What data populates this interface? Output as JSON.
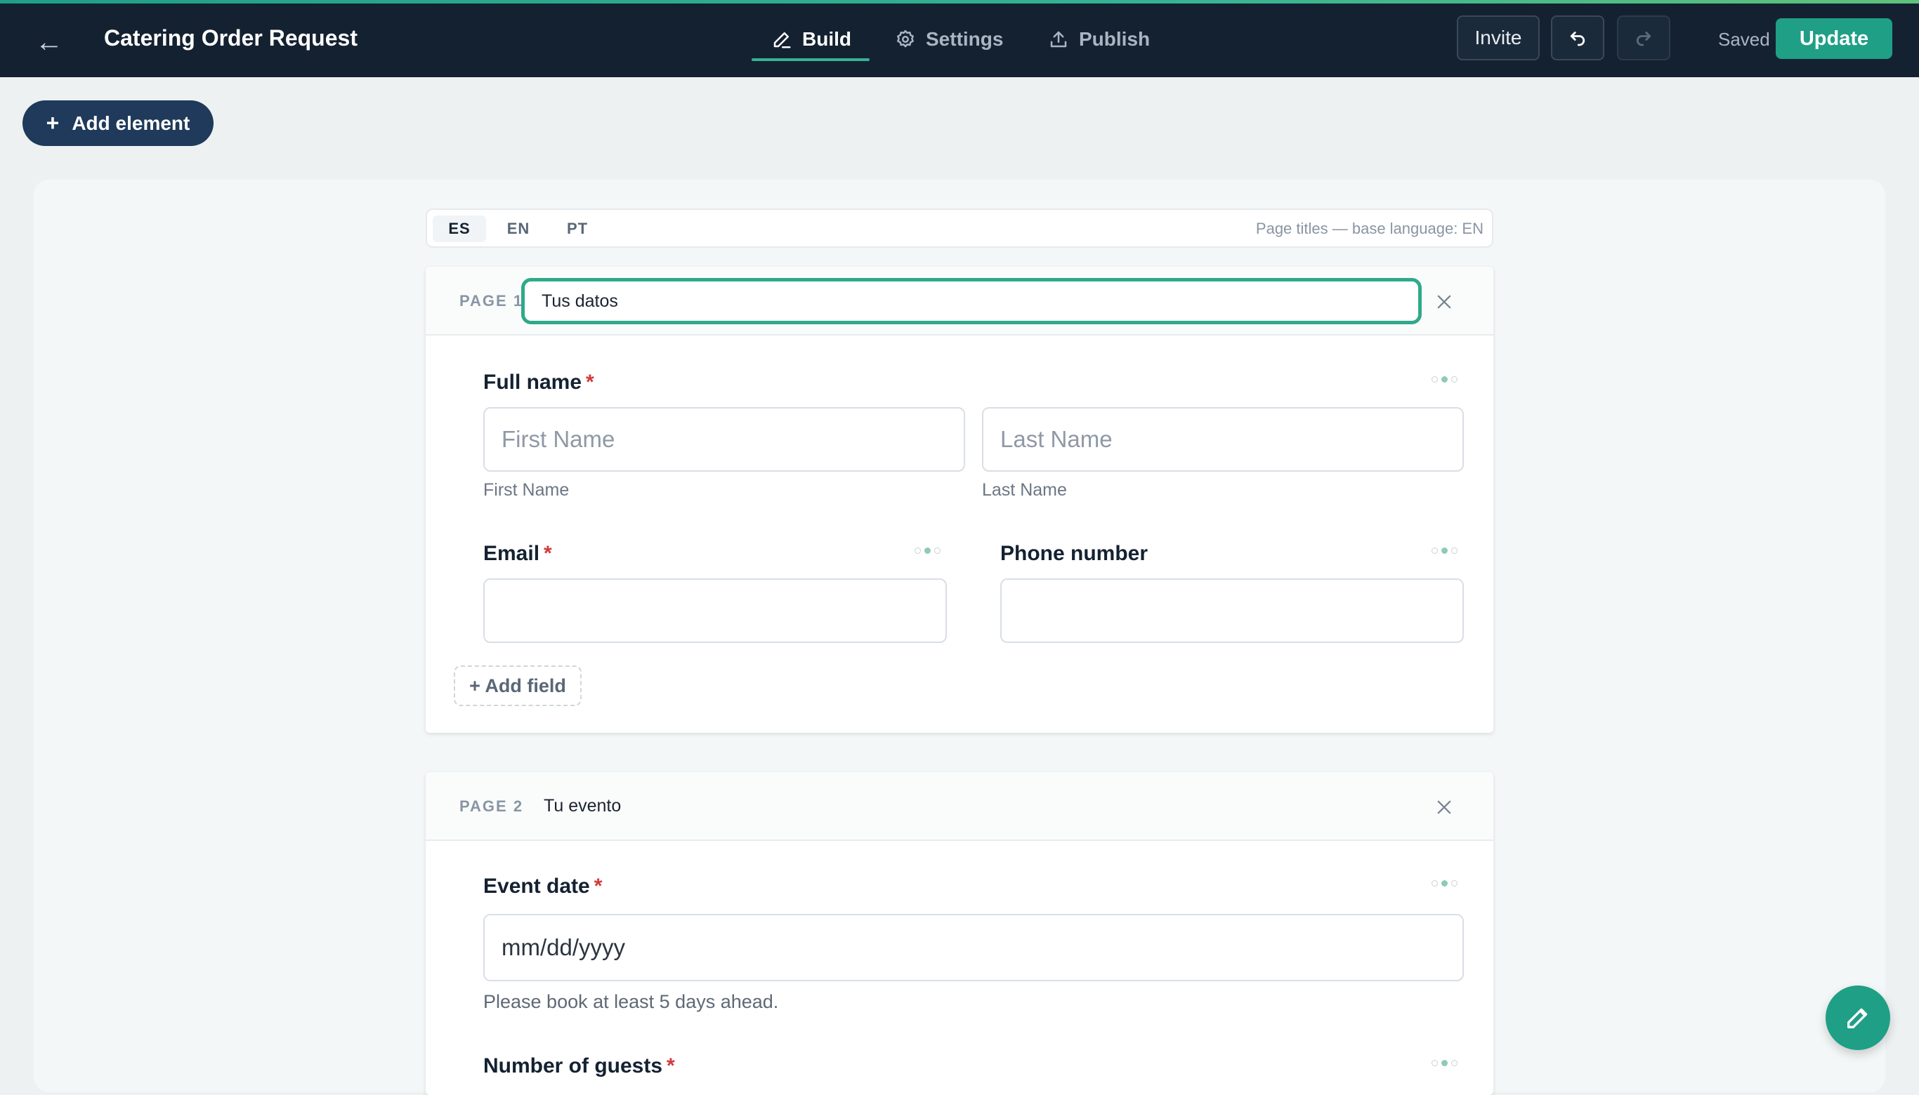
{
  "header": {
    "title": "Catering Order Request",
    "tabs": [
      {
        "label": "Build",
        "icon": "pencil-icon"
      },
      {
        "label": "Settings",
        "icon": "gear-icon"
      },
      {
        "label": "Publish",
        "icon": "upload-icon"
      }
    ],
    "invite_label": "Invite",
    "saved_label": "Saved",
    "update_label": "Update"
  },
  "toolbar": {
    "add_element_label": "Add element"
  },
  "languages": {
    "tabs": [
      "ES",
      "EN",
      "PT"
    ],
    "selected": "ES",
    "note": "Page titles — base language: EN"
  },
  "pages": [
    {
      "label": "PAGE 1",
      "title": "Tus datos",
      "fields": {
        "full_name": {
          "label": "Full name",
          "first_placeholder": "First Name",
          "last_placeholder": "Last Name",
          "first_sublabel": "First Name",
          "last_sublabel": "Last Name"
        },
        "email": {
          "label": "Email"
        },
        "phone": {
          "label": "Phone number"
        }
      },
      "add_field_label": "+ Add field"
    },
    {
      "label": "PAGE 2",
      "title": "Tu evento",
      "fields": {
        "event_date": {
          "label": "Event date",
          "placeholder": "mm/dd/yyyy",
          "help": "Please book at least 5 days ahead."
        },
        "guests": {
          "label": "Number of guests"
        }
      }
    }
  ],
  "required_mark": "*",
  "colors": {
    "header_bg": "#142131",
    "accent": "#1f9f86",
    "required": "#d23a3a"
  }
}
